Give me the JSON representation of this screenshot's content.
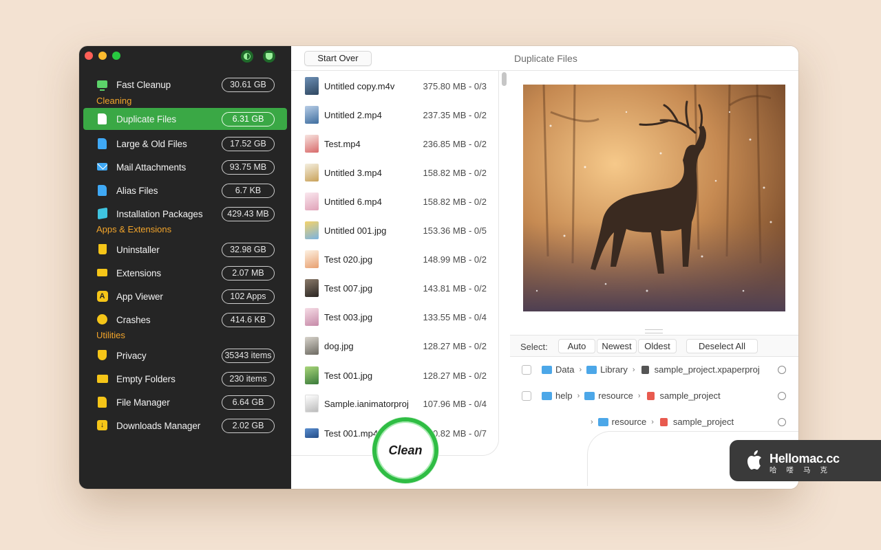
{
  "sidebar": {
    "fast_cleanup": {
      "label": "Fast Cleanup",
      "value": "30.61 GB",
      "icon": "monitor-icon"
    },
    "section_cleaning": "Cleaning",
    "cleaning_items": [
      {
        "label": "Duplicate Files",
        "value": "6.31 GB",
        "icon": "duplicate-file-icon",
        "active": true
      },
      {
        "label": "Large & Old Files",
        "value": "17.52 GB",
        "icon": "large-file-icon"
      },
      {
        "label": "Mail Attachments",
        "value": "93.75 MB",
        "icon": "mail-icon"
      },
      {
        "label": "Alias Files",
        "value": "6.7 KB",
        "icon": "alias-file-icon"
      },
      {
        "label": "Installation Packages",
        "value": "429.43 MB",
        "icon": "package-icon"
      }
    ],
    "section_apps": "Apps & Extensions",
    "app_items": [
      {
        "label": "Uninstaller",
        "value": "32.98 GB",
        "icon": "trash-icon"
      },
      {
        "label": "Extensions",
        "value": "2.07 MB",
        "icon": "plugin-icon"
      },
      {
        "label": "App Viewer",
        "value": "102 Apps",
        "icon": "app-store-icon"
      },
      {
        "label": "Crashes",
        "value": "414.6 KB",
        "icon": "crash-icon"
      }
    ],
    "section_utilities": "Utilities",
    "utility_items": [
      {
        "label": "Privacy",
        "value": "35343 items",
        "icon": "shield-icon"
      },
      {
        "label": "Empty Folders",
        "value": "230 items",
        "icon": "folder-icon"
      },
      {
        "label": "File Manager",
        "value": "6.64 GB",
        "icon": "file-manager-icon"
      },
      {
        "label": "Downloads Manager",
        "value": "2.02 GB",
        "icon": "download-icon"
      }
    ],
    "accent_color": "#3aa845",
    "section_color": "#f3a52b"
  },
  "header": {
    "start_over": "Start Over",
    "title": "Duplicate Files"
  },
  "files": [
    {
      "name": "Untitled copy.m4v",
      "size": "375.80 MB - 0/3"
    },
    {
      "name": "Untitled 2.mp4",
      "size": "237.35 MB - 0/2"
    },
    {
      "name": "Test.mp4",
      "size": "236.85 MB - 0/2"
    },
    {
      "name": "Untitled 3.mp4",
      "size": "158.82 MB - 0/2"
    },
    {
      "name": "Untitled 6.mp4",
      "size": "158.82 MB - 0/2"
    },
    {
      "name": "Untitled 001.jpg",
      "size": "153.36 MB - 0/5"
    },
    {
      "name": "Test 020.jpg",
      "size": "148.99 MB - 0/2"
    },
    {
      "name": "Test 007.jpg",
      "size": "143.81 MB - 0/2"
    },
    {
      "name": "Test 003.jpg",
      "size": "133.55 MB - 0/4"
    },
    {
      "name": "dog.jpg",
      "size": "128.27 MB - 0/2"
    },
    {
      "name": "Test 001.jpg",
      "size": "128.27 MB - 0/2"
    },
    {
      "name": "Sample.ianimatorproj",
      "size": "107.96 MB - 0/4"
    },
    {
      "name": "Test 001.mp4",
      "size": "90.82 MB - 0/7"
    }
  ],
  "select_bar": {
    "label": "Select:",
    "auto": "Auto",
    "newest": "Newest",
    "oldest": "Oldest",
    "deselect_all": "Deselect All"
  },
  "paths": [
    {
      "crumbs": [
        "Data",
        "Library"
      ],
      "file": "sample_project.xpaperproj"
    },
    {
      "crumbs": [
        "help",
        "resource"
      ],
      "file": "sample_project"
    },
    {
      "crumbs": [
        "resource"
      ],
      "file": "sample_project"
    }
  ],
  "clean_button": "Clean",
  "watermark": {
    "title": "Hellomac.cc",
    "subtitle": "哈喽马克"
  }
}
